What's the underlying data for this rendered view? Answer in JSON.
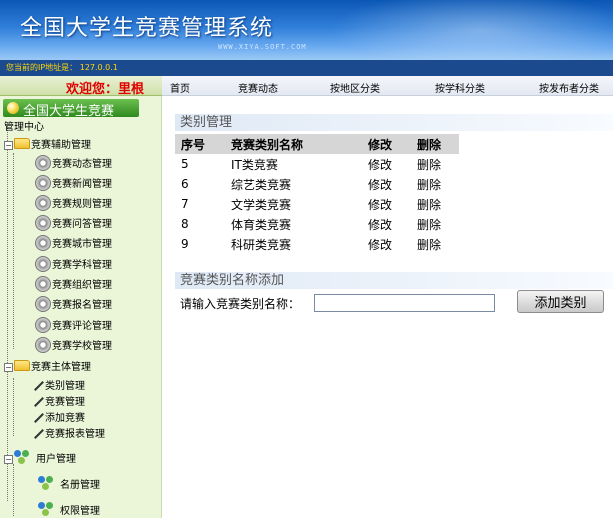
{
  "banner": {
    "title": "全国大学生竞赛管理系统",
    "watermark": "WWW.XIYA.SOFT.COM"
  },
  "ip_line": "您当前的IP地址是： 127.0.0.1",
  "welcome": "欢迎您：里根",
  "top_nav": [
    "首页",
    "竞赛动态",
    "按地区分类",
    "按学科分类",
    "按发布者分类"
  ],
  "sidebar": {
    "header": "全国大学生竞赛",
    "root": "管理中心",
    "group1": {
      "label": "竞赛辅助管理",
      "items": [
        "竞赛动态管理",
        "竞赛新闻管理",
        "竞赛规则管理",
        "竞赛问答管理",
        "竞赛城市管理",
        "竞赛学科管理",
        "竞赛组织管理",
        "竞赛报名管理",
        "竞赛评论管理",
        "竞赛学校管理"
      ]
    },
    "group2": {
      "label": "竞赛主体管理",
      "items": [
        "类别管理",
        "竞赛管理",
        "添加竞赛",
        "竞赛报表管理"
      ]
    },
    "group3": {
      "label": "用户管理",
      "items": [
        "名册管理",
        "权限管理"
      ]
    }
  },
  "main": {
    "section_title": "类别管理",
    "table": {
      "headers": [
        "序号",
        "竞赛类别名称",
        "修改",
        "删除"
      ],
      "rows": [
        {
          "id": "5",
          "name": "IT类竞赛",
          "edit": "修改",
          "del": "删除"
        },
        {
          "id": "6",
          "name": "综艺类竞赛",
          "edit": "修改",
          "del": "删除"
        },
        {
          "id": "7",
          "name": "文学类竞赛",
          "edit": "修改",
          "del": "删除"
        },
        {
          "id": "8",
          "name": "体育类竞赛",
          "edit": "修改",
          "del": "删除"
        },
        {
          "id": "9",
          "name": "科研类竞赛",
          "edit": "修改",
          "del": "删除"
        }
      ]
    },
    "add_section_title": "竞赛类别名称添加",
    "input_label": "请输入竞赛类别名称：",
    "input_value": "",
    "add_button": "添加类别"
  }
}
